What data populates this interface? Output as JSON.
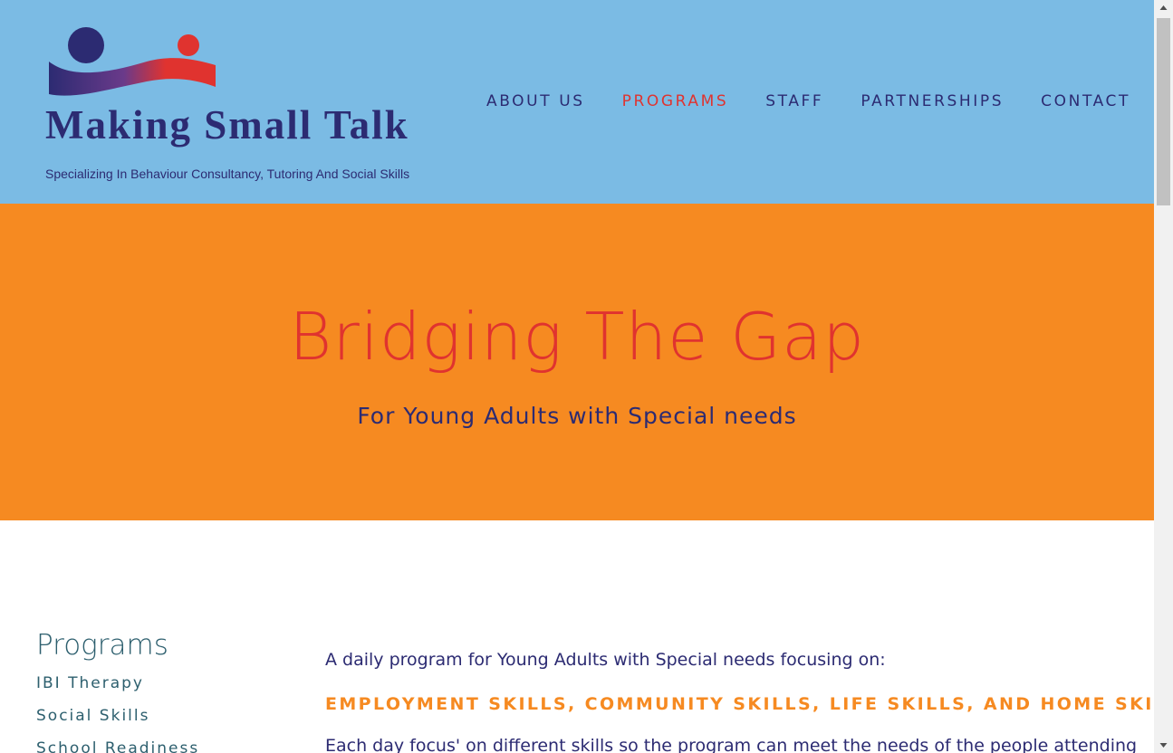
{
  "header": {
    "logo_title": "Making Small Talk",
    "logo_tagline": "Specializing In Behaviour Consultancy, Tutoring And Social Skills",
    "nav": [
      {
        "label": "ABOUT US",
        "active": false
      },
      {
        "label": "PROGRAMS",
        "active": true
      },
      {
        "label": "STAFF",
        "active": false
      },
      {
        "label": "PARTNERSHIPS",
        "active": false
      },
      {
        "label": "CONTACT",
        "active": false
      }
    ]
  },
  "hero": {
    "title": "Bridging The Gap",
    "subtitle": "For Young Adults with Special needs"
  },
  "sidebar": {
    "title": "Programs",
    "links": [
      "IBI Therapy",
      "Social Skills",
      "School Readiness"
    ]
  },
  "main": {
    "intro": "A daily program for Young Adults with Special needs focusing on:",
    "skills_heading": "EMPLOYMENT SKILLS, COMMUNITY SKILLS, LIFE SKILLS, AND HOME SKILLS",
    "body": "Each day focus' on different skills so the program can meet the needs of the people attending"
  },
  "colors": {
    "header_bg": "#7bbbe4",
    "hero_bg": "#f68a21",
    "brand_navy": "#2c2b72",
    "accent_red": "#e0332f",
    "accent_orange": "#f68a21"
  },
  "icons": {
    "logo_mark": "two-figures-wave-logo",
    "scroll_up": "triangle-up-icon",
    "scroll_down": "triangle-down-icon"
  }
}
